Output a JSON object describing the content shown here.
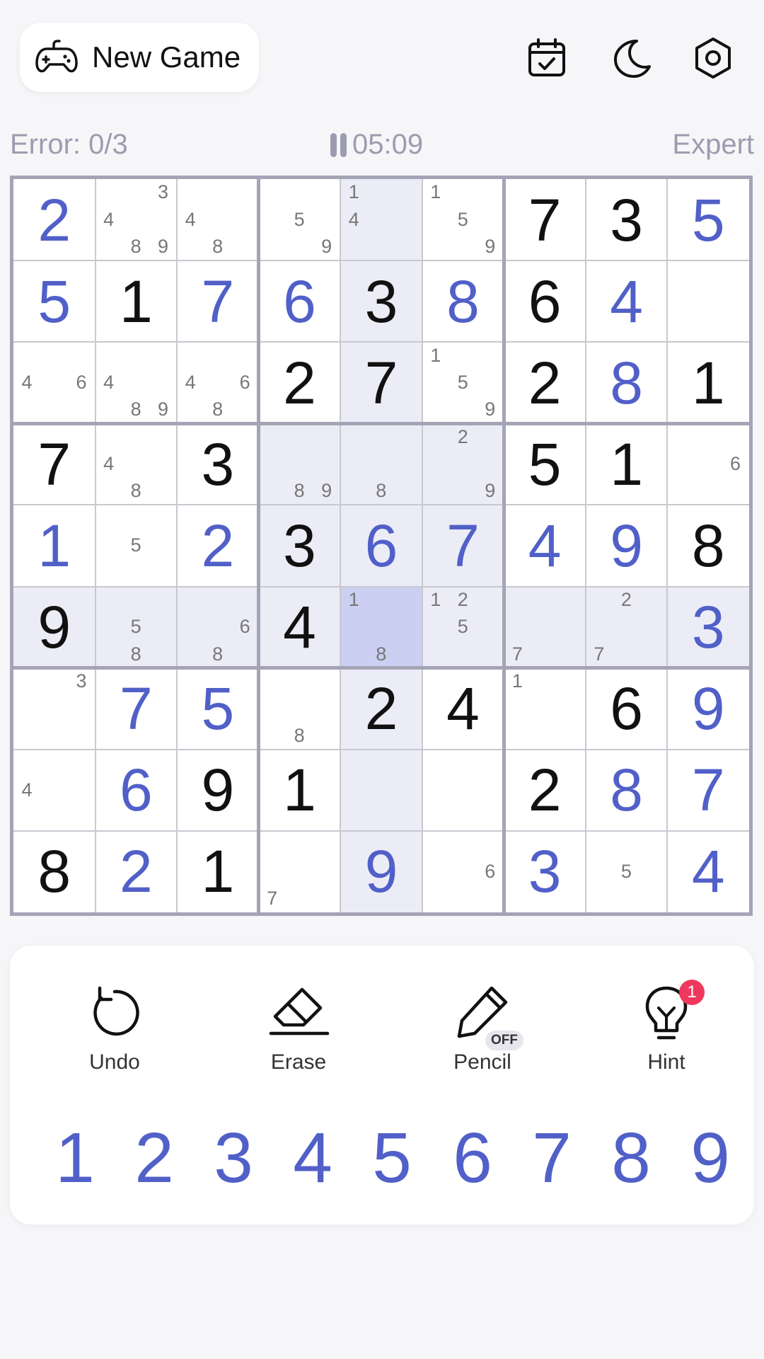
{
  "header": {
    "new_game_label": "New Game"
  },
  "status": {
    "errors": "Error: 0/3",
    "timer": "05:09",
    "difficulty": "Expert"
  },
  "colors": {
    "accent": "#5160c8",
    "given": "#111111",
    "note": "#777777",
    "highlight": "#ececf7",
    "selected": "#cbd0f2",
    "badge": "#f0385c"
  },
  "board": {
    "selected": [
      5,
      4
    ],
    "rows": [
      [
        {
          "v": 2,
          "u": 1
        },
        {
          "n": [
            3,
            4,
            8,
            9
          ]
        },
        {
          "n": [
            4,
            8
          ]
        },
        {
          "n": [
            5,
            9
          ]
        },
        {
          "n": [
            1,
            4
          ]
        },
        {
          "n": [
            1,
            5,
            9
          ]
        },
        {
          "v": 7
        },
        {
          "v": 3
        },
        {
          "v": 5,
          "u": 1
        }
      ],
      [
        {
          "v": 5,
          "u": 1
        },
        {
          "v": 1
        },
        {
          "v": 7,
          "u": 1
        },
        {
          "v": 6,
          "u": 1
        },
        {
          "v": 3
        },
        {
          "v": 8,
          "u": 1
        },
        {
          "v": 6
        },
        {
          "v": 4,
          "u": 1
        },
        {}
      ],
      [
        {
          "n": [
            4,
            6
          ]
        },
        {
          "n": [
            4,
            8,
            9
          ]
        },
        {
          "n": [
            4,
            6,
            8
          ]
        },
        {
          "v": 2
        },
        {
          "v": 7
        },
        {
          "n": [
            1,
            5,
            9
          ]
        },
        {
          "v": 2
        },
        {
          "v": 8,
          "u": 1
        },
        {
          "v": 1
        }
      ],
      [
        {
          "v": 7
        },
        {
          "n": [
            4,
            8
          ]
        },
        {
          "v": 3
        },
        {
          "n": [
            8,
            9
          ]
        },
        {
          "n": [
            8
          ]
        },
        {
          "n": [
            2,
            9
          ]
        },
        {
          "v": 5
        },
        {
          "v": 1
        },
        {
          "n": [
            6
          ]
        }
      ],
      [
        {
          "v": 1,
          "u": 1
        },
        {
          "n": [
            5
          ]
        },
        {
          "v": 2,
          "u": 1
        },
        {
          "v": 3
        },
        {
          "v": 6,
          "u": 1
        },
        {
          "v": 7,
          "u": 1
        },
        {
          "v": 4,
          "u": 1
        },
        {
          "v": 9,
          "u": 1
        },
        {
          "v": 8
        }
      ],
      [
        {
          "v": 9
        },
        {
          "n": [
            5,
            8
          ]
        },
        {
          "n": [
            6,
            8
          ]
        },
        {
          "v": 4
        },
        {
          "n": [
            1,
            8
          ]
        },
        {
          "n": [
            1,
            2,
            5
          ]
        },
        {
          "n": [
            7
          ]
        },
        {
          "n": [
            2,
            7
          ]
        },
        {
          "v": 3,
          "u": 1
        }
      ],
      [
        {
          "n": [
            3
          ]
        },
        {
          "v": 7,
          "u": 1
        },
        {
          "v": 5,
          "u": 1
        },
        {
          "n": [
            8
          ]
        },
        {
          "v": 2
        },
        {
          "v": 4
        },
        {
          "n": [
            1
          ]
        },
        {
          "v": 6
        },
        {
          "v": 9,
          "u": 1
        }
      ],
      [
        {
          "n": [
            4
          ]
        },
        {
          "v": 6,
          "u": 1
        },
        {
          "v": 9
        },
        {
          "v": 1
        },
        {},
        {},
        {
          "v": 2
        },
        {
          "v": 8,
          "u": 1
        },
        {
          "v": 7,
          "u": 1
        }
      ],
      [
        {
          "v": 8
        },
        {
          "v": 2,
          "u": 1
        },
        {
          "v": 1
        },
        {
          "n": [
            7
          ]
        },
        {
          "v": 9,
          "u": 1
        },
        {
          "n": [
            6
          ]
        },
        {
          "v": 3,
          "u": 1
        },
        {
          "n": [
            5
          ]
        },
        {
          "v": 4,
          "u": 1
        }
      ]
    ]
  },
  "tools": {
    "undo": "Undo",
    "erase": "Erase",
    "pencil": "Pencil",
    "pencil_state": "OFF",
    "hint": "Hint",
    "hint_count": "1"
  },
  "numpad": [
    "1",
    "2",
    "3",
    "4",
    "5",
    "6",
    "7",
    "8",
    "9"
  ],
  "icons": [
    "gamepad-icon",
    "calendar-check-icon",
    "moon-icon",
    "settings-hex-icon",
    "pause-icon",
    "undo-icon",
    "eraser-icon",
    "pencil-icon",
    "lightbulb-icon"
  ]
}
